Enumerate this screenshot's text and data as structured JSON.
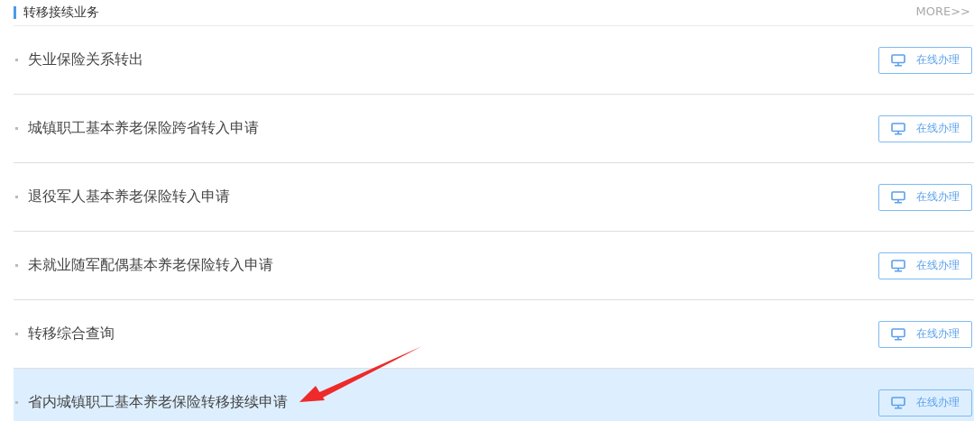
{
  "section": {
    "title": "转移接续业务",
    "more_link": "MORE>>"
  },
  "services": [
    {
      "name": "失业保险关系转出",
      "button": "在线办理",
      "highlighted": false
    },
    {
      "name": "城镇职工基本养老保险跨省转入申请",
      "button": "在线办理",
      "highlighted": false
    },
    {
      "name": "退役军人基本养老保险转入申请",
      "button": "在线办理",
      "highlighted": false
    },
    {
      "name": "未就业随军配偶基本养老保险转入申请",
      "button": "在线办理",
      "highlighted": false
    },
    {
      "name": "转移综合查询",
      "button": "在线办理",
      "highlighted": false
    },
    {
      "name": "省内城镇职工基本养老保险转移接续申请",
      "button": "在线办理",
      "highlighted": true
    }
  ]
}
